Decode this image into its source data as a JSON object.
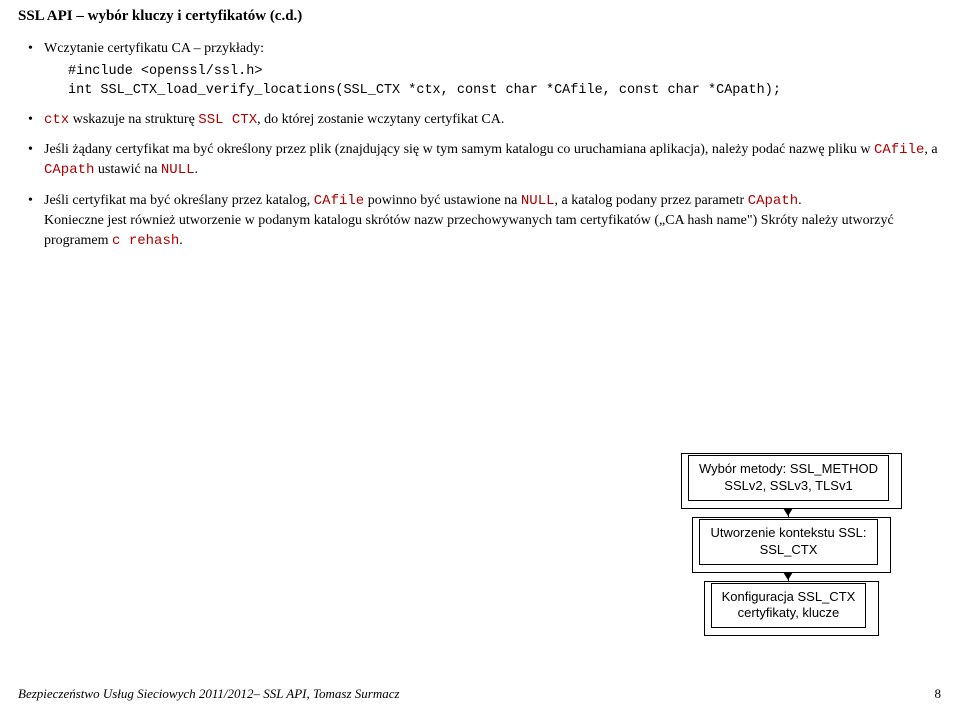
{
  "title": "SSL API – wybór kluczy i certyfikatów (c.d.)",
  "bullet1": "Wczytanie certyfikatu CA – przykłady:",
  "code": "#include <openssl/ssl.h>\nint SSL_CTX_load_verify_locations(SSL_CTX *ctx, const char *CAfile, const char *CApath);",
  "bullet2_pre": "",
  "bullet2_ctx": "ctx",
  "bullet2_mid": " wskazuje na strukturę ",
  "bullet2_sslctx": "SSL CTX",
  "bullet2_post": ", do której zostanie wczytany certyfikat CA.",
  "bullet3_a": "Jeśli żądany certyfikat ma być określony przez plik (znajdujący się w tym samym katalogu co uruchamiana aplikacja), należy podać nazwę pliku w ",
  "bullet3_cafile": "CAfile",
  "bullet3_b": ", a ",
  "bullet3_capath": "CApath",
  "bullet3_c": " ustawić na ",
  "bullet3_null": "NULL",
  "bullet3_d": ".",
  "bullet4_a": "Jeśli certyfikat ma być określany przez katalog, ",
  "bullet4_cafile": "CAfile",
  "bullet4_b": " powinno być ustawione na ",
  "bullet4_null": "NULL",
  "bullet4_c": ", a katalog podany przez parametr ",
  "bullet4_capath": "CApath",
  "bullet4_d": ".",
  "bullet4_line2_a": "Konieczne jest również utworzenie w podanym katalogu skrótów nazw przechowywanych tam certyfikatów („CA hash name\") Skróty należy utworzyć programem ",
  "bullet4_rehash": "c rehash",
  "bullet4_line2_b": ".",
  "diagram": {
    "box1_l1": "Wybór metody: SSL_METHOD",
    "box1_l2": "SSLv2, SSLv3, TLSv1",
    "box2_l1": "Utworzenie kontekstu SSL:",
    "box2_l2": "SSL_CTX",
    "box3_l1": "Konfiguracja SSL_CTX",
    "box3_l2": "certyfikaty, klucze"
  },
  "footer_left": "Bezpieczeństwo Usług Sieciowych 2011/2012– SSL API, Tomasz Surmacz",
  "footer_page": "8"
}
